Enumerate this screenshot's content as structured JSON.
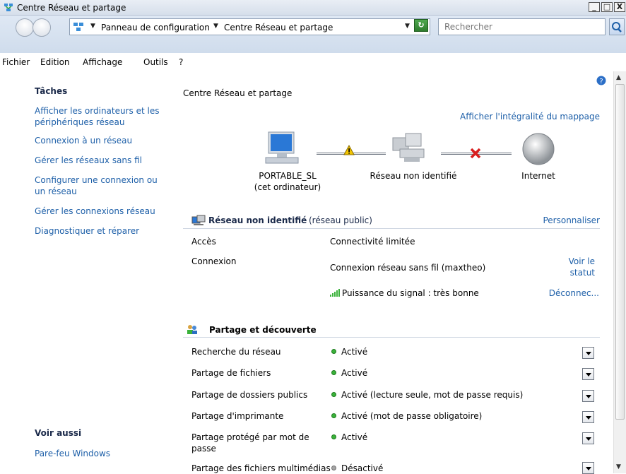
{
  "window": {
    "title": "Centre Réseau et partage",
    "minimize": "_",
    "restore": "□",
    "close": "X"
  },
  "address": {
    "crumbs": [
      "Panneau de configuration",
      "Centre Réseau et partage"
    ],
    "search_placeholder": "Rechercher"
  },
  "menu": [
    "Fichier",
    "Edition",
    "Affichage",
    "Outils",
    "?"
  ],
  "sidebar": {
    "tasks_heading": "Tâches",
    "tasks": [
      "Afficher les ordinateurs et les périphériques réseau",
      "Connexion à un réseau",
      "Gérer les réseaux sans fil",
      "Configurer une connexion ou un réseau",
      "Gérer les connexions réseau",
      "Diagnostiquer et réparer"
    ],
    "see_also_heading": "Voir aussi",
    "see_also": [
      "Pare-feu Windows"
    ]
  },
  "main": {
    "title": "Centre Réseau et partage",
    "map_link": "Afficher l'intégralité du mappage",
    "map": {
      "computer_name": "PORTABLE_SL",
      "computer_sub": "(cet ordinateur)",
      "network": "Réseau non identifié",
      "internet": "Internet"
    },
    "network_section": {
      "name": "Réseau non identifié",
      "type": "(réseau public)",
      "customize": "Personnaliser",
      "rows": [
        {
          "label": "Accès",
          "value": "Connectivité limitée",
          "link": ""
        },
        {
          "label": "Connexion",
          "value": "Connexion réseau sans fil (maxtheo)",
          "link": "Voir le statut"
        },
        {
          "label": "",
          "value": "Puissance du signal : très bonne",
          "link": "Déconnec..."
        }
      ]
    },
    "sharing_section": {
      "title": "Partage et découverte",
      "rows": [
        {
          "label": "Recherche du réseau",
          "value": "Activé",
          "on": true
        },
        {
          "label": "Partage de fichiers",
          "value": "Activé",
          "on": true
        },
        {
          "label": "Partage de dossiers publics",
          "value": "Activé (lecture seule, mot de passe requis)",
          "on": true
        },
        {
          "label": "Partage d'imprimante",
          "value": "Activé (mot de passe obligatoire)",
          "on": true
        },
        {
          "label": "Partage protégé par mot de passe",
          "value": "Activé",
          "on": true
        },
        {
          "label": "Partage des fichiers multimédias",
          "value": "Désactivé",
          "on": false
        }
      ]
    }
  },
  "colors": {
    "link": "#1d5fa8",
    "status_on": "#3ab23a",
    "status_off": "#a5a5a5",
    "warning": "#f2c400",
    "error": "#d81e1e"
  }
}
